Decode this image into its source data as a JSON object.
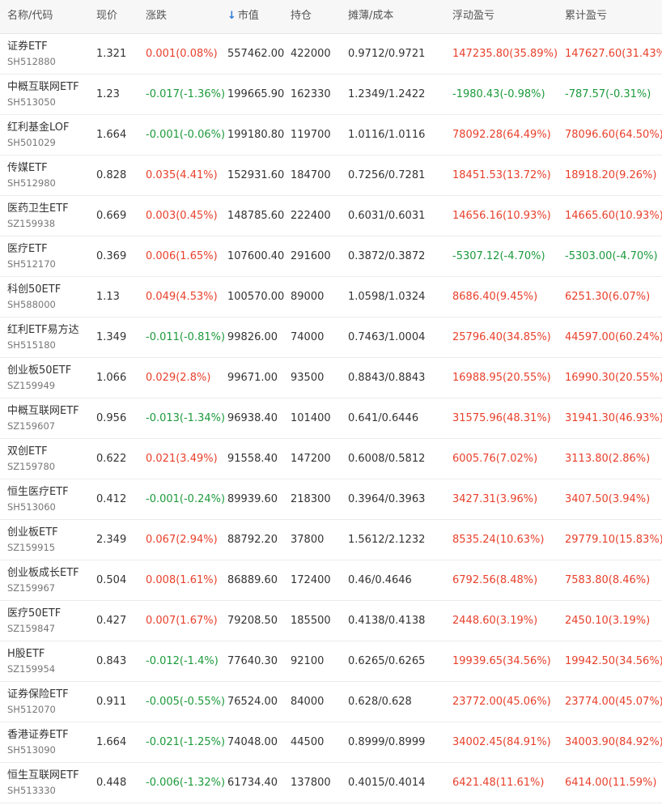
{
  "header": {
    "name_code": "名称/代码",
    "price": "现价",
    "change": "涨跌",
    "market_value_arrow": "↓",
    "market_value": "市值",
    "holding": "持仓",
    "cost": "摊薄/成本",
    "float_pl": "浮动盈亏",
    "total_pl": "累计盈亏"
  },
  "colors": {
    "up": "#e8402c",
    "down": "#1d9a3c",
    "sort_arrow": "#2f7ad8"
  },
  "rows": [
    {
      "name": "证券ETF",
      "code": "SH512880",
      "price": "1.321",
      "change": "0.001(0.08%)",
      "change_dir": "up",
      "market_value": "557462.00",
      "holding": "422000",
      "cost": "0.9712/0.9721",
      "float_pl": "147235.80(35.89%)",
      "float_dir": "up",
      "total_pl": "147627.60(31.43%)",
      "total_dir": "up"
    },
    {
      "name": "中概互联网ETF",
      "code": "SH513050",
      "price": "1.23",
      "change": "-0.017(-1.36%)",
      "change_dir": "down",
      "market_value": "199665.90",
      "holding": "162330",
      "cost": "1.2349/1.2422",
      "float_pl": "-1980.43(-0.98%)",
      "float_dir": "down",
      "total_pl": "-787.57(-0.31%)",
      "total_dir": "down"
    },
    {
      "name": "红利基金LOF",
      "code": "SH501029",
      "price": "1.664",
      "change": "-0.001(-0.06%)",
      "change_dir": "down",
      "market_value": "199180.80",
      "holding": "119700",
      "cost": "1.0116/1.0116",
      "float_pl": "78092.28(64.49%)",
      "float_dir": "up",
      "total_pl": "78096.60(64.50%)",
      "total_dir": "up"
    },
    {
      "name": "传媒ETF",
      "code": "SH512980",
      "price": "0.828",
      "change": "0.035(4.41%)",
      "change_dir": "up",
      "market_value": "152931.60",
      "holding": "184700",
      "cost": "0.7256/0.7281",
      "float_pl": "18451.53(13.72%)",
      "float_dir": "up",
      "total_pl": "18918.20(9.26%)",
      "total_dir": "up"
    },
    {
      "name": "医药卫生ETF",
      "code": "SZ159938",
      "price": "0.669",
      "change": "0.003(0.45%)",
      "change_dir": "up",
      "market_value": "148785.60",
      "holding": "222400",
      "cost": "0.6031/0.6031",
      "float_pl": "14656.16(10.93%)",
      "float_dir": "up",
      "total_pl": "14665.60(10.93%)",
      "total_dir": "up"
    },
    {
      "name": "医疗ETF",
      "code": "SH512170",
      "price": "0.369",
      "change": "0.006(1.65%)",
      "change_dir": "up",
      "market_value": "107600.40",
      "holding": "291600",
      "cost": "0.3872/0.3872",
      "float_pl": "-5307.12(-4.70%)",
      "float_dir": "down",
      "total_pl": "-5303.00(-4.70%)",
      "total_dir": "down"
    },
    {
      "name": "科创50ETF",
      "code": "SH588000",
      "price": "1.13",
      "change": "0.049(4.53%)",
      "change_dir": "up",
      "market_value": "100570.00",
      "holding": "89000",
      "cost": "1.0598/1.0324",
      "float_pl": "8686.40(9.45%)",
      "float_dir": "up",
      "total_pl": "6251.30(6.07%)",
      "total_dir": "up"
    },
    {
      "name": "红利ETF易方达",
      "code": "SH515180",
      "price": "1.349",
      "change": "-0.011(-0.81%)",
      "change_dir": "down",
      "market_value": "99826.00",
      "holding": "74000",
      "cost": "0.7463/1.0004",
      "float_pl": "25796.40(34.85%)",
      "float_dir": "up",
      "total_pl": "44597.00(60.24%)",
      "total_dir": "up"
    },
    {
      "name": "创业板50ETF",
      "code": "SZ159949",
      "price": "1.066",
      "change": "0.029(2.8%)",
      "change_dir": "up",
      "market_value": "99671.00",
      "holding": "93500",
      "cost": "0.8843/0.8843",
      "float_pl": "16988.95(20.55%)",
      "float_dir": "up",
      "total_pl": "16990.30(20.55%)",
      "total_dir": "up"
    },
    {
      "name": "中概互联网ETF",
      "code": "SZ159607",
      "price": "0.956",
      "change": "-0.013(-1.34%)",
      "change_dir": "down",
      "market_value": "96938.40",
      "holding": "101400",
      "cost": "0.641/0.6446",
      "float_pl": "31575.96(48.31%)",
      "float_dir": "up",
      "total_pl": "31941.30(46.93%)",
      "total_dir": "up"
    },
    {
      "name": "双创ETF",
      "code": "SZ159780",
      "price": "0.622",
      "change": "0.021(3.49%)",
      "change_dir": "up",
      "market_value": "91558.40",
      "holding": "147200",
      "cost": "0.6008/0.5812",
      "float_pl": "6005.76(7.02%)",
      "float_dir": "up",
      "total_pl": "3113.80(2.86%)",
      "total_dir": "up"
    },
    {
      "name": "恒生医疗ETF",
      "code": "SH513060",
      "price": "0.412",
      "change": "-0.001(-0.24%)",
      "change_dir": "down",
      "market_value": "89939.60",
      "holding": "218300",
      "cost": "0.3964/0.3963",
      "float_pl": "3427.31(3.96%)",
      "float_dir": "up",
      "total_pl": "3407.50(3.94%)",
      "total_dir": "up"
    },
    {
      "name": "创业板ETF",
      "code": "SZ159915",
      "price": "2.349",
      "change": "0.067(2.94%)",
      "change_dir": "up",
      "market_value": "88792.20",
      "holding": "37800",
      "cost": "1.5612/2.1232",
      "float_pl": "8535.24(10.63%)",
      "float_dir": "up",
      "total_pl": "29779.10(15.83%)",
      "total_dir": "up"
    },
    {
      "name": "创业板成长ETF",
      "code": "SZ159967",
      "price": "0.504",
      "change": "0.008(1.61%)",
      "change_dir": "up",
      "market_value": "86889.60",
      "holding": "172400",
      "cost": "0.46/0.4646",
      "float_pl": "6792.56(8.48%)",
      "float_dir": "up",
      "total_pl": "7583.80(8.46%)",
      "total_dir": "up"
    },
    {
      "name": "医疗50ETF",
      "code": "SZ159847",
      "price": "0.427",
      "change": "0.007(1.67%)",
      "change_dir": "up",
      "market_value": "79208.50",
      "holding": "185500",
      "cost": "0.4138/0.4138",
      "float_pl": "2448.60(3.19%)",
      "float_dir": "up",
      "total_pl": "2450.10(3.19%)",
      "total_dir": "up"
    },
    {
      "name": "H股ETF",
      "code": "SZ159954",
      "price": "0.843",
      "change": "-0.012(-1.4%)",
      "change_dir": "down",
      "market_value": "77640.30",
      "holding": "92100",
      "cost": "0.6265/0.6265",
      "float_pl": "19939.65(34.56%)",
      "float_dir": "up",
      "total_pl": "19942.50(34.56%)",
      "total_dir": "up"
    },
    {
      "name": "证券保险ETF",
      "code": "SH512070",
      "price": "0.911",
      "change": "-0.005(-0.55%)",
      "change_dir": "down",
      "market_value": "76524.00",
      "holding": "84000",
      "cost": "0.628/0.628",
      "float_pl": "23772.00(45.06%)",
      "float_dir": "up",
      "total_pl": "23774.00(45.07%)",
      "total_dir": "up"
    },
    {
      "name": "香港证券ETF",
      "code": "SH513090",
      "price": "1.664",
      "change": "-0.021(-1.25%)",
      "change_dir": "down",
      "market_value": "74048.00",
      "holding": "44500",
      "cost": "0.8999/0.8999",
      "float_pl": "34002.45(84.91%)",
      "float_dir": "up",
      "total_pl": "34003.90(84.92%)",
      "total_dir": "up"
    },
    {
      "name": "恒生互联网ETF",
      "code": "SH513330",
      "price": "0.448",
      "change": "-0.006(-1.32%)",
      "change_dir": "down",
      "market_value": "61734.40",
      "holding": "137800",
      "cost": "0.4015/0.4014",
      "float_pl": "6421.48(11.61%)",
      "float_dir": "up",
      "total_pl": "6414.00(11.59%)",
      "total_dir": "up"
    }
  ]
}
